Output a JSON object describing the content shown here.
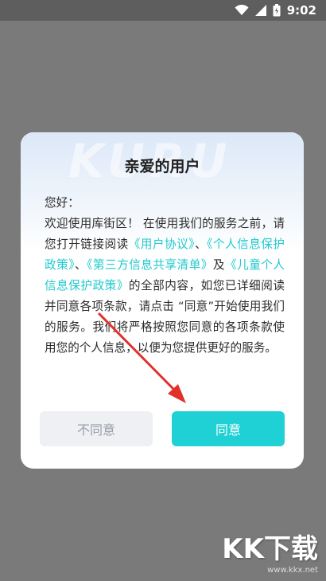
{
  "status_bar": {
    "time": "9:02",
    "icons": [
      "wifi-icon",
      "signal-icon",
      "battery-icon"
    ]
  },
  "dialog": {
    "watermark": "KURU",
    "title": "亲爱的用户",
    "greeting": "您好：",
    "text_1": "欢迎使用库街区！ 在使用我们的服务之前，请您打开链接阅读",
    "link_user_agreement": "《用户协议》",
    "sep_1": "、",
    "link_privacy_policy": "《个人信息保护政策》",
    "sep_2": "、",
    "link_third_party": "《第三方信息共享清单》",
    "text_2": "及",
    "link_children_privacy": "《儿童个人信息保护政策》",
    "text_3": "的全部内容，如您已详细阅读并同意各项条款，请点击 “同意”开始使用我们的服务。我们将严格按照您同意的各项条款使用您的个人信息，以便为您提供更好的服务。",
    "disagree_label": "不同意",
    "agree_label": "同意"
  },
  "watermark_logo": {
    "main": "KK下载",
    "sub": "www.kkx.net"
  },
  "colors": {
    "accent": "#1fd1d5",
    "link": "#1ec9cf",
    "overlay": "#7a7a7a",
    "arrow": "#e0312a"
  }
}
